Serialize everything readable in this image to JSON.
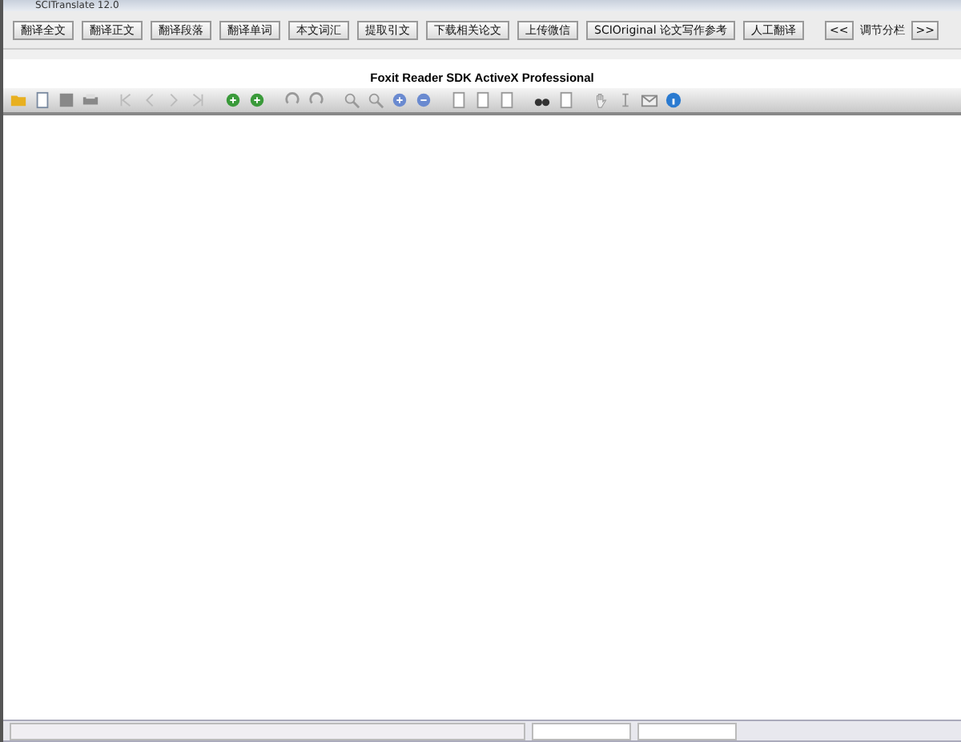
{
  "window": {
    "title": "SCITranslate 12.0"
  },
  "buttons": [
    {
      "label": "翻译全文"
    },
    {
      "label": "翻译正文"
    },
    {
      "label": "翻译段落"
    },
    {
      "label": "翻译单词"
    },
    {
      "label": "本文词汇"
    },
    {
      "label": "提取引文"
    },
    {
      "label": "下载相关论文"
    },
    {
      "label": "上传微信"
    },
    {
      "label": "SCIOriginal 论文写作参考"
    },
    {
      "label": "人工翻译"
    }
  ],
  "column_nav": {
    "prev": "<<",
    "label": "调节分栏",
    "next": ">>"
  },
  "viewer": {
    "title": "Foxit Reader SDK ActiveX Professional"
  }
}
